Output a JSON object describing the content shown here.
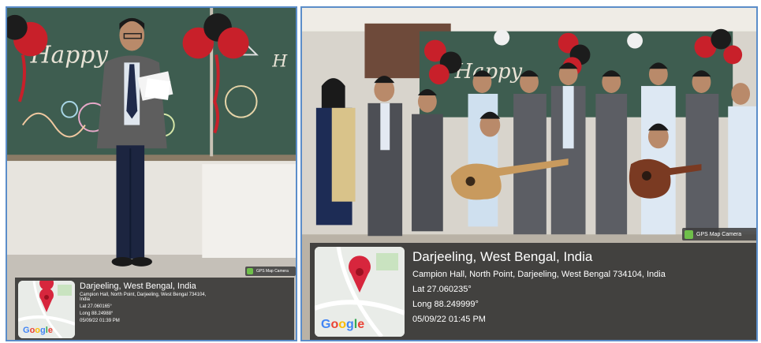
{
  "photo1": {
    "title": "Darjeeling, West Bengal, India",
    "address": "Campion Hall, North Point, Darjeeling, West Bengal 734104,",
    "address2": "India",
    "lat": "Lat 27.060165°",
    "long": "Long 88.24988°",
    "datetime": "05/09/22 01:39 PM",
    "map_brand": "Google",
    "badge": "GPS Map Camera",
    "board_text": "Happy"
  },
  "photo2": {
    "title": "Darjeeling, West Bengal, India",
    "address": "Campion Hall, North Point, Darjeeling, West Bengal 734104, India",
    "lat": "Lat 27.060235°",
    "long": "Long 88.249999°",
    "datetime": "05/09/22 01:45 PM",
    "map_brand": "Google",
    "badge": "GPS Map Camera",
    "board_text": "Happy"
  },
  "colors": {
    "chalkboard": "#3b5a4d",
    "balloon_red": "#c8202a",
    "balloon_black": "#1c1c1c",
    "overlay": "#2a2a2a",
    "pin": "#d7263d",
    "frame": "#5b8dc9"
  }
}
